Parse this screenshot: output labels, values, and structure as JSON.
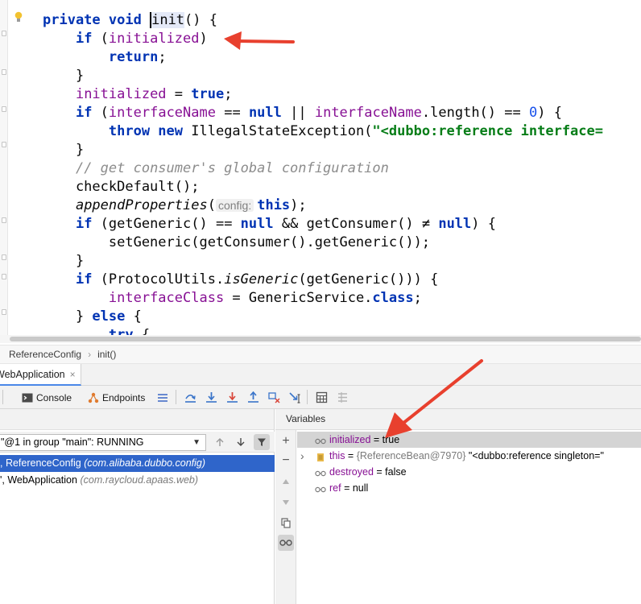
{
  "editor": {
    "code_lines": [
      [
        {
          "t": "private ",
          "c": "kw"
        },
        {
          "t": "void ",
          "c": "kw"
        },
        {
          "t": "i",
          "c": "caret hl"
        },
        {
          "t": "nit",
          "c": "hl"
        },
        {
          "t": "() {",
          "c": ""
        }
      ],
      [
        {
          "t": "    ",
          "c": ""
        },
        {
          "t": "if ",
          "c": "kw"
        },
        {
          "t": "(",
          "c": ""
        },
        {
          "t": "initialized",
          "c": "fld"
        },
        {
          "t": ")",
          "c": ""
        }
      ],
      [
        {
          "t": "        ",
          "c": ""
        },
        {
          "t": "return",
          "c": "kw"
        },
        {
          "t": ";",
          "c": ""
        }
      ],
      [
        {
          "t": "    }",
          "c": ""
        }
      ],
      [
        {
          "t": "    ",
          "c": ""
        },
        {
          "t": "initialized",
          "c": "fld"
        },
        {
          "t": " = ",
          "c": ""
        },
        {
          "t": "true",
          "c": "kw"
        },
        {
          "t": ";",
          "c": ""
        }
      ],
      [
        {
          "t": "    ",
          "c": ""
        },
        {
          "t": "if ",
          "c": "kw"
        },
        {
          "t": "(",
          "c": ""
        },
        {
          "t": "interfaceName",
          "c": "fld"
        },
        {
          "t": " == ",
          "c": ""
        },
        {
          "t": "null",
          "c": "kw"
        },
        {
          "t": " || ",
          "c": ""
        },
        {
          "t": "interfaceName",
          "c": "fld"
        },
        {
          "t": ".length() == ",
          "c": ""
        },
        {
          "t": "0",
          "c": "num"
        },
        {
          "t": ") {",
          "c": ""
        }
      ],
      [
        {
          "t": "        ",
          "c": ""
        },
        {
          "t": "throw new ",
          "c": "kw"
        },
        {
          "t": "IllegalStateException(",
          "c": ""
        },
        {
          "t": "\"<dubbo:reference interface=",
          "c": "str"
        }
      ],
      [
        {
          "t": "    }",
          "c": ""
        }
      ],
      [
        {
          "t": "    ",
          "c": ""
        },
        {
          "t": "// get consumer's global configuration",
          "c": "cmt"
        }
      ],
      [
        {
          "t": "    checkDefault();",
          "c": ""
        }
      ],
      [
        {
          "t": "    ",
          "c": ""
        },
        {
          "t": "appendProperties",
          "c": "it"
        },
        {
          "t": "(",
          "c": ""
        },
        {
          "t": "config:",
          "c": "hint"
        },
        {
          "t": "this",
          "c": "kw"
        },
        {
          "t": ");",
          "c": ""
        }
      ],
      [
        {
          "t": "    ",
          "c": ""
        },
        {
          "t": "if ",
          "c": "kw"
        },
        {
          "t": "(getGeneric() == ",
          "c": ""
        },
        {
          "t": "null",
          "c": "kw"
        },
        {
          "t": " && getConsumer() ≠ ",
          "c": ""
        },
        {
          "t": "null",
          "c": "kw"
        },
        {
          "t": ") {",
          "c": ""
        }
      ],
      [
        {
          "t": "        setGeneric(getConsumer().getGeneric());",
          "c": ""
        }
      ],
      [
        {
          "t": "    }",
          "c": ""
        }
      ],
      [
        {
          "t": "    ",
          "c": ""
        },
        {
          "t": "if ",
          "c": "kw"
        },
        {
          "t": "(ProtocolUtils.",
          "c": ""
        },
        {
          "t": "isGeneric",
          "c": "it"
        },
        {
          "t": "(getGeneric())) {",
          "c": ""
        }
      ],
      [
        {
          "t": "        ",
          "c": ""
        },
        {
          "t": "interfaceClass",
          "c": "fld"
        },
        {
          "t": " = GenericService.",
          "c": ""
        },
        {
          "t": "class",
          "c": "kw"
        },
        {
          "t": ";",
          "c": ""
        }
      ],
      [
        {
          "t": "    } ",
          "c": ""
        },
        {
          "t": "else ",
          "c": "kw"
        },
        {
          "t": "{",
          "c": ""
        }
      ],
      [
        {
          "t": "        ",
          "c": ""
        },
        {
          "t": "try ",
          "c": "kw"
        },
        {
          "t": "{",
          "c": ""
        }
      ]
    ]
  },
  "breadcrumb": {
    "class_name": "ReferenceConfig",
    "method_name": "init()"
  },
  "debug": {
    "tab_label": "WebApplication",
    "tab_close": "×",
    "toolbar": {
      "console_label": "Console",
      "endpoints_label": "Endpoints"
    }
  },
  "frames": {
    "thread_label": "\"@1 in group \"main\": RUNNING",
    "items": [
      {
        "method": ", ReferenceConfig",
        "pkg": "(com.alibaba.dubbo.config)"
      },
      {
        "method": "', WebApplication",
        "pkg": "(com.raycloud.apaas.web)"
      }
    ]
  },
  "variables": {
    "title": "Variables",
    "items": [
      {
        "name": "initialized",
        "eq": " = ",
        "type": "",
        "value": "true"
      },
      {
        "name": "this",
        "eq": " = ",
        "type": "{ReferenceBean@7970} ",
        "value": "\"<dubbo:reference singleton=\""
      },
      {
        "name": "destroyed",
        "eq": " = ",
        "type": "",
        "value": "false"
      },
      {
        "name": "ref",
        "eq": " = ",
        "type": "",
        "value": "null"
      }
    ]
  },
  "colors": {
    "arrow": "#e8402e",
    "selection": "#2f65ca",
    "keyword": "#0033b3",
    "field": "#871094"
  }
}
